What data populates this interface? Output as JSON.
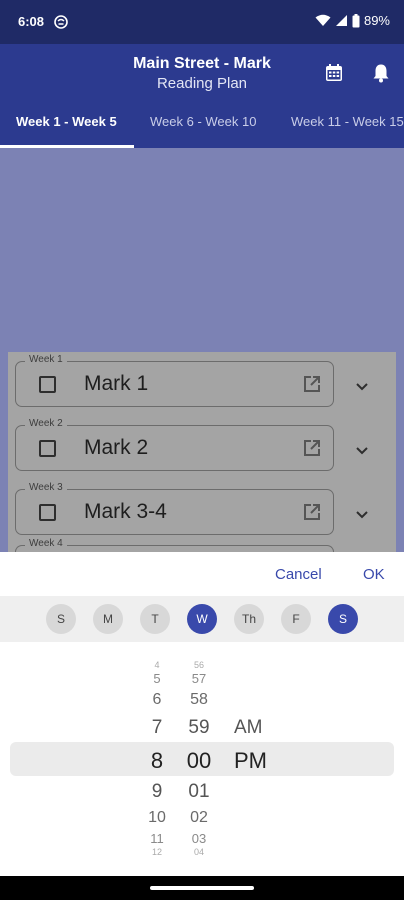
{
  "status_bar": {
    "time": "6:08",
    "battery": "89%"
  },
  "header": {
    "title": "Main Street - Mark",
    "subtitle": "Reading Plan",
    "icons": [
      "calendar-icon",
      "bell-icon"
    ]
  },
  "tabs": [
    {
      "label": "Week 1 - Week 5",
      "active": true
    },
    {
      "label": "Week 6 - Week 10",
      "active": false
    },
    {
      "label": "Week 11 - Week 15",
      "active": false
    }
  ],
  "weeks": [
    {
      "legend": "Week 1",
      "title": "Mark 1"
    },
    {
      "legend": "Week 2",
      "title": "Mark 2"
    },
    {
      "legend": "Week 3",
      "title": "Mark 3-4"
    },
    {
      "legend": "Week 4"
    }
  ],
  "dialog": {
    "cancel": "Cancel",
    "ok": "OK",
    "days": [
      {
        "label": "S",
        "selected": false
      },
      {
        "label": "M",
        "selected": false
      },
      {
        "label": "T",
        "selected": false
      },
      {
        "label": "W",
        "selected": true
      },
      {
        "label": "Th",
        "selected": false
      },
      {
        "label": "F",
        "selected": false
      },
      {
        "label": "S",
        "selected": true
      }
    ],
    "hours": [
      "4",
      "5",
      "6",
      "7",
      "8",
      "9",
      "10",
      "11",
      "12"
    ],
    "minutes": [
      "56",
      "57",
      "58",
      "59",
      "00",
      "01",
      "02",
      "03",
      "04"
    ],
    "ampm": [
      "AM",
      "PM"
    ],
    "selected_hour": "8",
    "selected_minute": "00",
    "selected_ampm": "PM"
  }
}
